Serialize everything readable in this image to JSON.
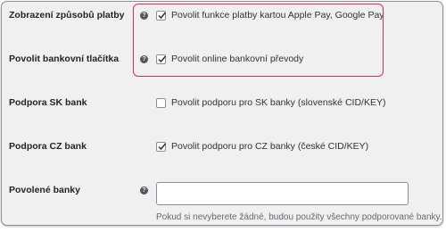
{
  "colors": {
    "highlight": "#d6334a",
    "background": "#f0f0f1",
    "checkbox_check": "#2c3338"
  },
  "rows": [
    {
      "label": "Zobrazení způsobů platby",
      "help": "?",
      "checkbox": {
        "checked": true,
        "text": "Povolit funkce platby kartou Apple Pay, Google Pay"
      }
    },
    {
      "label": "Povolit bankovní tlačítka",
      "help": "?",
      "checkbox": {
        "checked": true,
        "text": "Povolit online bankovní převody"
      }
    },
    {
      "label": "Podpora SK bank",
      "checkbox": {
        "checked": false,
        "text": "Povolit podporu pro SK banky (slovenské CID/KEY)"
      }
    },
    {
      "label": "Podpora CZ bank",
      "checkbox": {
        "checked": true,
        "text": "Povolit podporu pro CZ banky (české CID/KEY)"
      }
    },
    {
      "label": "Povolené banky",
      "help": "?",
      "input_value": "",
      "description": "Pokud si nevyberete žádné, budou použity všechny podporované banky."
    }
  ]
}
